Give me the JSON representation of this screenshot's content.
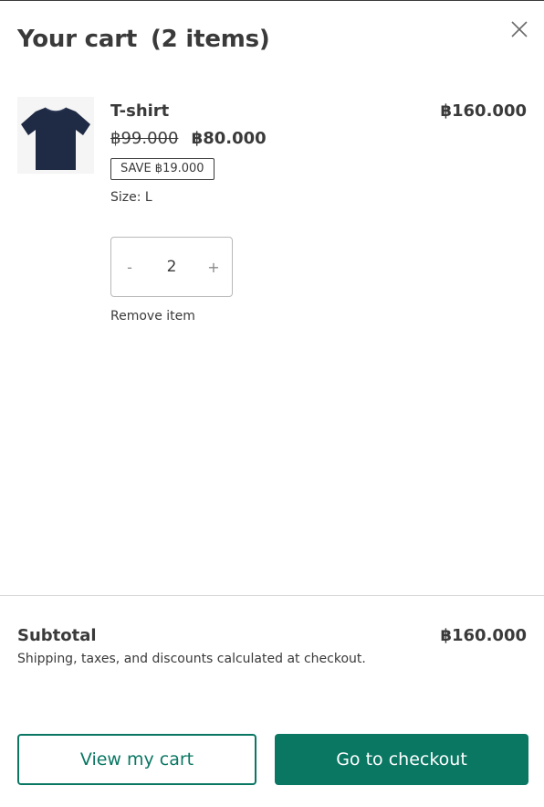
{
  "header": {
    "title": "Your cart",
    "count": "(2 items)",
    "close_icon": "close-icon"
  },
  "cart": {
    "items": [
      {
        "image_icon": "tshirt-image",
        "image_color": "#1f2a44",
        "name": "T-shirt",
        "line_total": "฿160.000",
        "original_price": "฿99.000",
        "sale_price": "฿80.000",
        "save_badge": "SAVE ฿19.000",
        "variant": "Size: L",
        "quantity": "2",
        "decrease_label": "-",
        "increase_label": "+",
        "remove_label": "Remove item"
      }
    ]
  },
  "footer": {
    "subtotal_label": "Subtotal",
    "subtotal_value": "฿160.000",
    "note": "Shipping, taxes, and discounts calculated at checkout.",
    "view_cart_label": "View my cart",
    "checkout_label": "Go to checkout"
  },
  "colors": {
    "accent": "#0a7763",
    "text": "#3a3a3a"
  }
}
